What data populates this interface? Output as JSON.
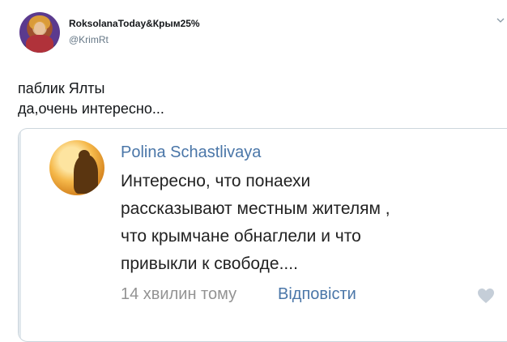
{
  "author": {
    "name": "RoksolanaToday&Крым25%",
    "handle": "@KrimRt"
  },
  "tweet": {
    "lines": [
      "паблик Ялты",
      "да,очень интересно..."
    ]
  },
  "quoted_comment": {
    "name": "Polina Schastlivaya",
    "lines": [
      "Интересно, что понаехи",
      "рассказывают местным жителям ,",
      "что крымчане обнаглели и что",
      "привыкли к свободе...."
    ],
    "time": "14 хвилин тому",
    "reply_label": "Відповісти"
  },
  "colors": {
    "link_blue": "#4a76a8",
    "muted_gray": "#939393",
    "handle_gray": "#657786"
  },
  "icons": [
    "author-avatar",
    "chevron-down-icon",
    "commenter-avatar",
    "heart-icon"
  ]
}
